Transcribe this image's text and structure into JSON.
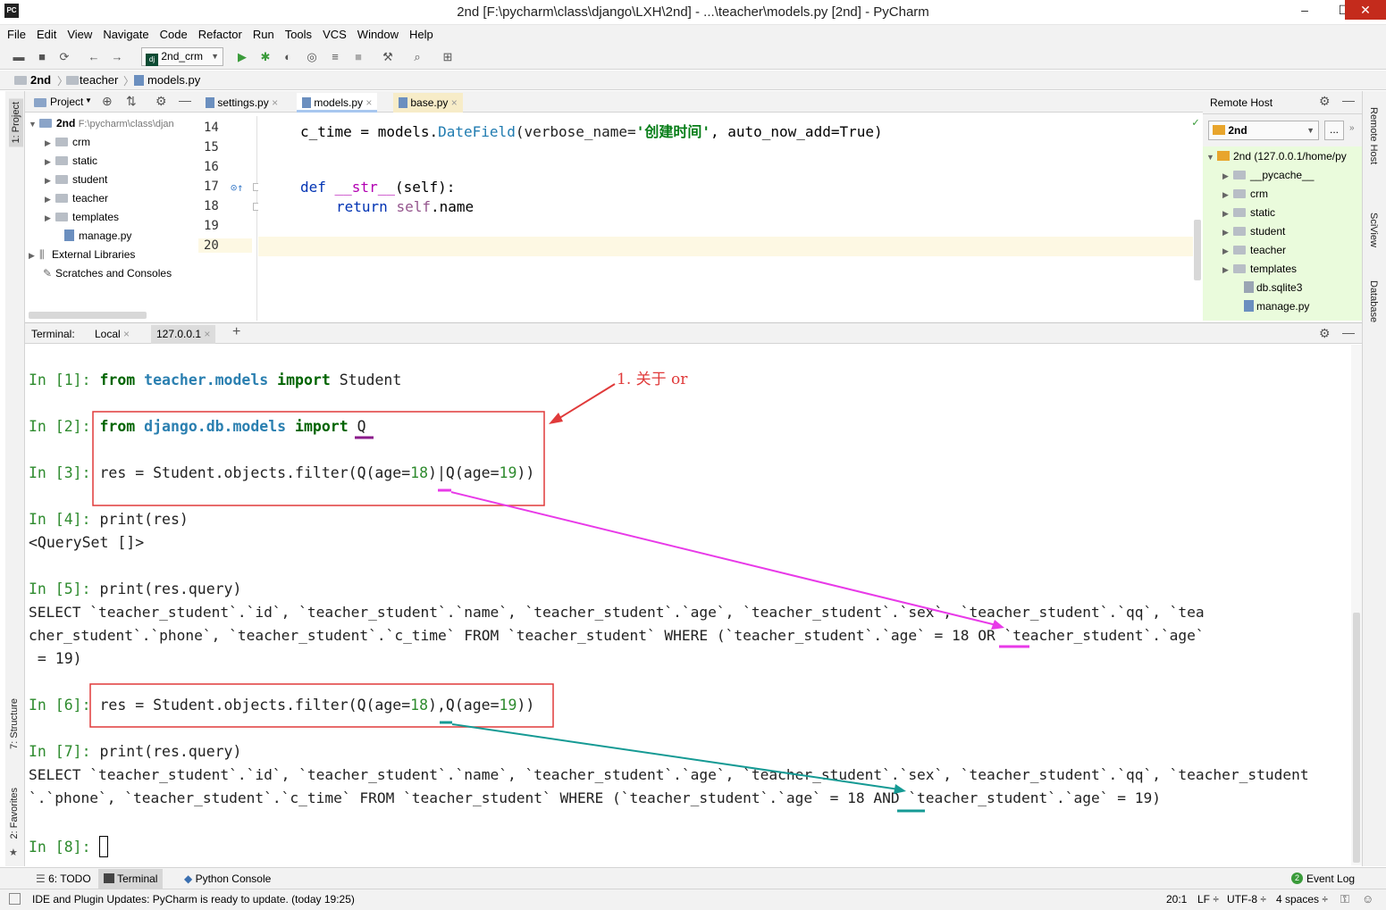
{
  "window": {
    "title": "2nd [F:\\pycharm\\class\\django\\LXH\\2nd] - ...\\teacher\\models.py [2nd] - PyCharm",
    "app_icon": "PC",
    "controls": [
      "–",
      "☐",
      "✕"
    ]
  },
  "menu": [
    "File",
    "Edit",
    "View",
    "Navigate",
    "Code",
    "Refactor",
    "Run",
    "Tools",
    "VCS",
    "Window",
    "Help"
  ],
  "toolbar": {
    "run_config": "2nd_crm"
  },
  "breadcrumb": [
    "2nd",
    "teacher",
    "models.py"
  ],
  "left_strip": {
    "project": "1: Project",
    "structure": "7: Structure",
    "favorites": "2: Favorites"
  },
  "right_strip": {
    "remote_host": "Remote Host",
    "sciview": "SciView",
    "database": "Database"
  },
  "project_panel": {
    "title": "Project",
    "root": {
      "name": "2nd",
      "path": "F:\\pycharm\\class\\djan"
    },
    "items": [
      {
        "label": "crm",
        "type": "folder"
      },
      {
        "label": "static",
        "type": "folder"
      },
      {
        "label": "student",
        "type": "folder"
      },
      {
        "label": "teacher",
        "type": "folder"
      },
      {
        "label": "templates",
        "type": "folder"
      },
      {
        "label": "manage.py",
        "type": "file"
      }
    ],
    "external": "External Libraries",
    "scratches": "Scratches and Consoles"
  },
  "editor": {
    "tabs": [
      {
        "label": "settings.py",
        "active": false
      },
      {
        "label": "models.py",
        "active": true
      },
      {
        "label": "base.py",
        "active": false
      }
    ],
    "line_numbers": [
      "14",
      "15",
      "16",
      "17",
      "18",
      "19",
      "20"
    ],
    "lines": {
      "l14_a": "c_time = models.",
      "l14_b": "DateField",
      "l14_c": "(verbose_name=",
      "l14_d": "'创建时间'",
      "l14_e": ", auto_now_add=True)",
      "l17_a": "def ",
      "l17_b": "__str__",
      "l17_c": "(self):",
      "l18_a": "return ",
      "l18_b": "self",
      "l18_c": ".name"
    }
  },
  "remote_host": {
    "title": "Remote Host",
    "server": "2nd",
    "browse": "...",
    "root": "2nd (127.0.0.1/home/py",
    "items": [
      {
        "label": "__pycache__",
        "type": "folder"
      },
      {
        "label": "crm",
        "type": "folder"
      },
      {
        "label": "static",
        "type": "folder"
      },
      {
        "label": "student",
        "type": "folder"
      },
      {
        "label": "teacher",
        "type": "folder"
      },
      {
        "label": "templates",
        "type": "folder"
      },
      {
        "label": "db.sqlite3",
        "type": "file"
      },
      {
        "label": "manage.py",
        "type": "file"
      }
    ]
  },
  "terminal": {
    "label": "Terminal:",
    "tabs": [
      "Local",
      "127.0.0.1"
    ],
    "add": "+",
    "lines": {
      "p1": "In [1]: ",
      "p1_from": "from ",
      "p1_mod": "teacher.models",
      "p1_imp": " import ",
      "p1_name": "Student",
      "p2": "In [2]: ",
      "p2_from": "from ",
      "p2_mod": "django.db.models",
      "p2_imp": " import ",
      "p2_name": "Q",
      "p3": "In [3]: ",
      "p3_a": "res = Student.objects.filter(Q(age=",
      "p3_n1": "18",
      "p3_b": ")|Q(age=",
      "p3_n2": "19",
      "p3_c": "))",
      "p4": "In [4]: ",
      "p4_a": "print(res)",
      "o4": "<QuerySet []>",
      "p5": "In [5]: ",
      "p5_a": "print(res.query)",
      "o5_1": "SELECT `teacher_student`.`id`, `teacher_student`.`name`, `teacher_student`.`age`, `teacher_student`.`sex`, `teacher_student`.`qq`, `tea",
      "o5_2": "cher_student`.`phone`, `teacher_student`.`c_time` FROM `teacher_student` WHERE (`teacher_student`.`age` = 18 OR `teacher_student`.`age`",
      "o5_3": " = 19)",
      "p6": "In [6]: ",
      "p6_a": "res = Student.objects.filter(Q(age=",
      "p6_n1": "18",
      "p6_b": "),Q(age=",
      "p6_n2": "19",
      "p6_c": "))",
      "p7": "In [7]: ",
      "p7_a": "print(res.query)",
      "o7_1": "SELECT `teacher_student`.`id`, `teacher_student`.`name`, `teacher_student`.`age`, `teacher_student`.`sex`, `teacher_student`.`qq`, `teacher_student",
      "o7_2": "`.`phone`, `teacher_student`.`c_time` FROM `teacher_student` WHERE (`teacher_student`.`age` = 18 AND `teacher_student`.`age` = 19)",
      "p8": "In [8]: "
    }
  },
  "annotation": {
    "text": "1. 关于 or",
    "red": "#e03a3a",
    "magenta": "#e83ae8",
    "teal": "#159a94"
  },
  "bottom_tabs": [
    {
      "label": "6: TODO"
    },
    {
      "label": "Terminal"
    },
    {
      "label": "Python Console"
    }
  ],
  "event_log": {
    "count": "2",
    "label": "Event Log"
  },
  "status": {
    "message": "IDE and Plugin Updates: PyCharm is ready to update. (today 19:25)",
    "position": "20:1",
    "line_sep": "LF ÷",
    "encoding": "UTF-8 ÷",
    "indent": "4 spaces ÷"
  }
}
